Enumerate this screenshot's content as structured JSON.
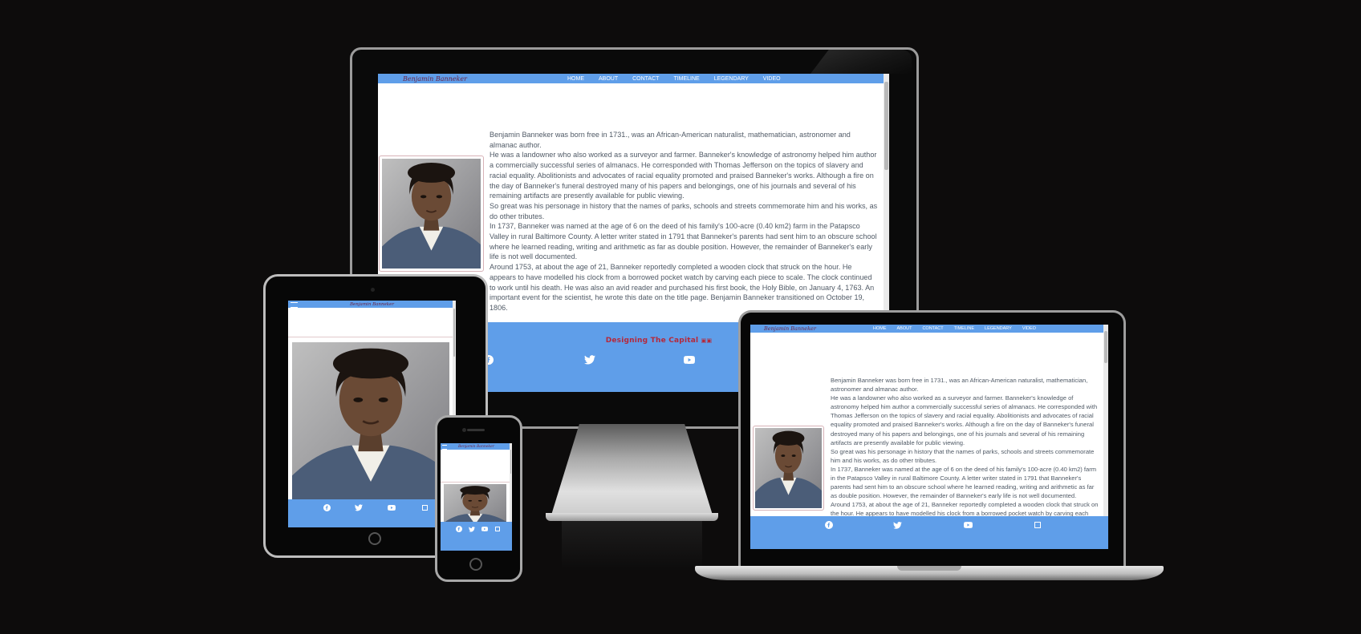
{
  "site": {
    "logo": "Benjamin Banneker",
    "nav": [
      "HOME",
      "ABOUT",
      "CONTACT",
      "TIMELINE",
      "LEGENDARY",
      "VIDEO"
    ],
    "paragraphs": [
      "Benjamin Banneker was born free in 1731., was an African-American naturalist, mathematician, astronomer and almanac author.",
      "He was a landowner who also worked as a surveyor and farmer. Banneker's knowledge of astronomy helped him author a commercially successful series of almanacs. He corresponded with Thomas Jefferson on the topics of slavery and racial equality. Abolitionists and advocates of racial equality promoted and praised Banneker's works. Although a fire on the day of Banneker's funeral destroyed many of his papers and belongings, one of his journals and several of his remaining artifacts are presently available for public viewing.",
      "So great was his personage in history that the names of parks, schools and streets commemorate him and his works, as do other tributes.",
      "In 1737, Banneker was named at the age of 6 on the deed of his family's 100-acre (0.40 km2) farm in the Patapsco Valley in rural Baltimore County. A letter writer stated in 1791 that Banneker's parents had sent him to an obscure school where he learned reading, writing and arithmetic as far as double position. However, the remainder of Banneker's early life is not well documented.",
      "Around 1753, at about the age of 21, Banneker reportedly completed a wooden clock that struck on the hour. He appears to have modelled his clock from a borrowed pocket watch by carving each piece to scale. The clock continued to work until his death. He was also an avid reader and purchased his first book, the Holy Bible, on January 4, 1763. An important event for the scientist, he wrote this date on the title page. Benjamin Banneker transitioned on October 19, 1806."
    ],
    "footer_credit": "Designing The Capital",
    "social_icons": [
      "facebook-icon",
      "twitter-icon",
      "youtube-icon",
      "square-icon"
    ]
  },
  "colors": {
    "background": "#0d0c0c",
    "navbar": "#5f9ee9",
    "footer": "#5f9ee9",
    "logo_text": "#6a2446",
    "credit_text": "#b5283a",
    "body_text": "#505a66"
  }
}
